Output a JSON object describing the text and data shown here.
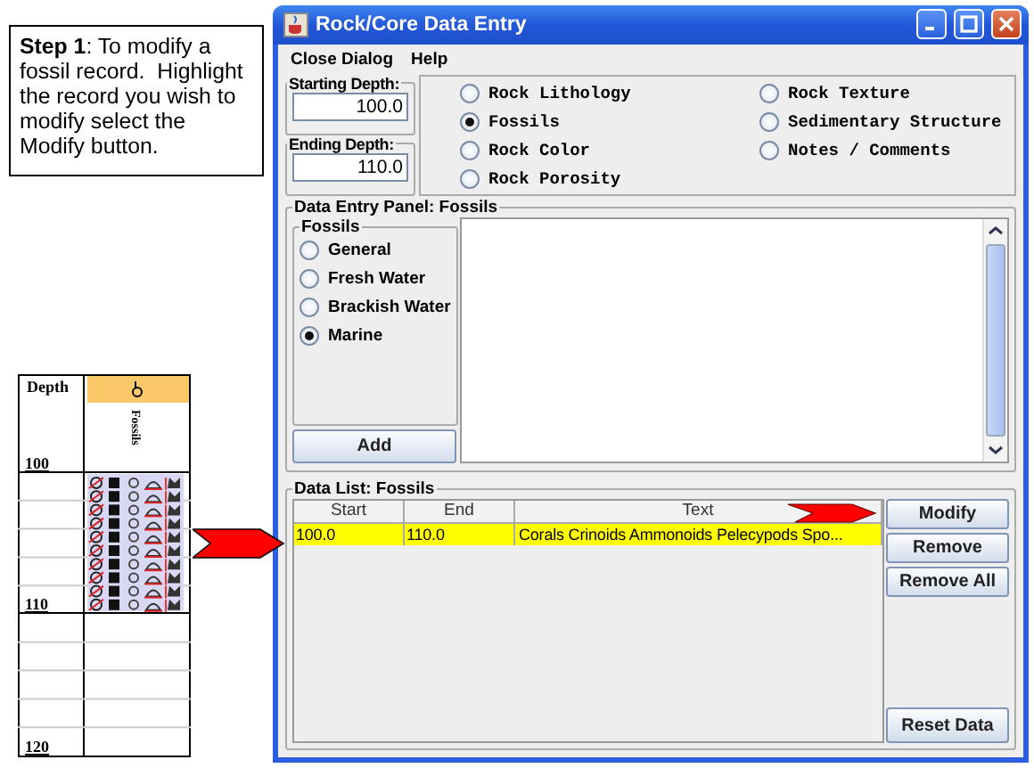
{
  "callout": {
    "text": "**Step 1**: To modify a fossil record.  Highlight the record you wish to modify select the Modify button."
  },
  "log": {
    "depth_header": "Depth",
    "column_title": "Fossils",
    "depth_labels": [
      "100",
      "110",
      "120"
    ]
  },
  "window": {
    "title": "Rock/Core Data Entry"
  },
  "menu": [
    "Close Dialog",
    "Help"
  ],
  "depth_fields": [
    {
      "label": "Starting Depth:",
      "value": "100.0"
    },
    {
      "label": "Ending Depth:",
      "value": "110.0"
    }
  ],
  "data_types": [
    {
      "label": "Rock Lithology",
      "selected": false
    },
    {
      "label": "Fossils",
      "selected": true
    },
    {
      "label": "Rock Color",
      "selected": false
    },
    {
      "label": "Rock Porosity",
      "selected": false
    },
    {
      "label": "Rock Texture",
      "selected": false
    },
    {
      "label": "Sedimentary Structure",
      "selected": false
    },
    {
      "label": "Notes / Comments",
      "selected": false
    }
  ],
  "entry_panel": {
    "title": "Data Entry Panel: Fossils",
    "group_title": "Fossils",
    "options": [
      {
        "label": "General",
        "selected": false
      },
      {
        "label": "Fresh Water",
        "selected": false
      },
      {
        "label": "Brackish Water",
        "selected": false
      },
      {
        "label": "Marine",
        "selected": true
      }
    ],
    "add_button": "Add"
  },
  "data_list": {
    "title": "Data List: Fossils",
    "columns": [
      "Start",
      "End",
      "Text"
    ],
    "rows": [
      {
        "cells": [
          "100.0",
          "110.0",
          "Corals Crinoids Ammonoids Pelecypods Spo..."
        ],
        "selected": true
      }
    ],
    "buttons": [
      "Modify",
      "Remove",
      "Remove All"
    ],
    "reset_button": "Reset Data"
  }
}
